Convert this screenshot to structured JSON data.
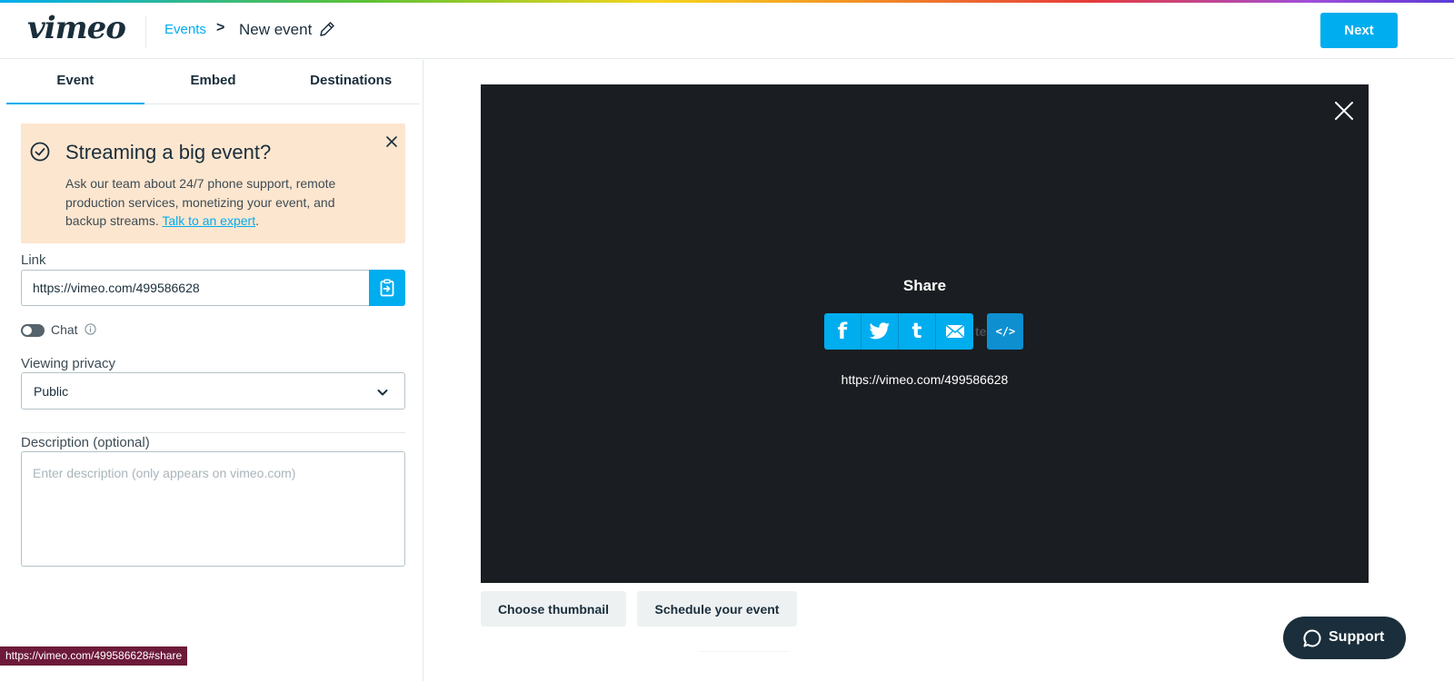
{
  "header": {
    "logo": "vimeo",
    "breadcrumb_link": "Events",
    "breadcrumb_separator": ">",
    "breadcrumb_current": "New event",
    "next_label": "Next"
  },
  "sidebar": {
    "tabs": [
      {
        "label": "Event",
        "active": true
      },
      {
        "label": "Embed",
        "active": false
      },
      {
        "label": "Destinations",
        "active": false
      }
    ],
    "promo": {
      "title": "Streaming a big event?",
      "body": "Ask our team about 24/7 phone support, remote production services, monetizing your event, and backup streams.",
      "link": "Talk to an expert",
      "trailing": "."
    },
    "link": {
      "label": "Link",
      "value": "https://vimeo.com/499586628"
    },
    "chat": {
      "label": "Chat",
      "enabled": false
    },
    "privacy": {
      "label": "Viewing privacy",
      "value": "Public"
    },
    "description": {
      "label": "Description (optional)",
      "placeholder": "Enter description (only appears on vimeo.com)"
    }
  },
  "player": {
    "share_title": "Share",
    "share_buttons": [
      "f",
      "t",
      "t",
      "email"
    ],
    "obscured_text": "te",
    "embed_label": "</>",
    "share_url": "https://vimeo.com/499586628"
  },
  "actions": {
    "choose_thumbnail": "Choose thumbnail",
    "schedule": "Schedule your event"
  },
  "support_label": "Support",
  "status_url": "https://vimeo.com/499586628#share",
  "colors": {
    "accent": "#00adef",
    "dark": "#1a2e3b",
    "promo_bg": "#fde6cf",
    "player_bg": "#1a1d21"
  }
}
